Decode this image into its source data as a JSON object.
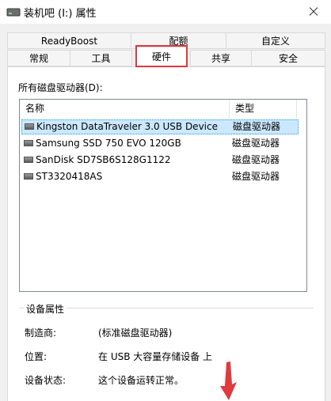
{
  "window": {
    "title": "装机吧 (I:) 属性"
  },
  "tabs": {
    "row1": [
      "ReadyBoost",
      "配额",
      "自定义"
    ],
    "row2": [
      "常规",
      "工具",
      "硬件",
      "共享",
      "安全"
    ],
    "active": "硬件"
  },
  "hardware": {
    "list_caption": "所有磁盘驱动器(D):",
    "columns": [
      "名称",
      "类型"
    ],
    "rows": [
      {
        "name": "Kingston DataTraveler 3.0 USB Device",
        "type": "磁盘驱动器",
        "selected": true
      },
      {
        "name": "Samsung SSD 750 EVO 120GB",
        "type": "磁盘驱动器",
        "selected": false
      },
      {
        "name": "SanDisk SD7SB6S128G1122",
        "type": "磁盘驱动器",
        "selected": false
      },
      {
        "name": "ST3320418AS",
        "type": "磁盘驱动器",
        "selected": false
      }
    ]
  },
  "device_properties": {
    "group_title": "设备属性",
    "manufacturer_label": "制造商:",
    "manufacturer_value": "(标准磁盘驱动器)",
    "location_label": "位置:",
    "location_value": "在 USB 大容量存储设备 上",
    "status_label": "设备状态:",
    "status_value": "这个设备运转正常。"
  },
  "colors": {
    "highlight_box": "#e0393e",
    "selection_bg": "#cce8ff",
    "annotation_arrow": "#e0393e"
  }
}
